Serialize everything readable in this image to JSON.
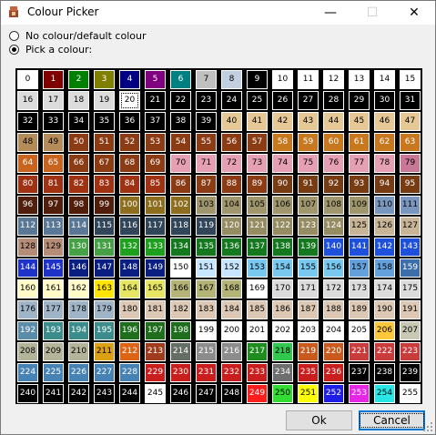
{
  "window": {
    "title": "Colour Picker"
  },
  "titlebar_buttons": {
    "minimize": "—",
    "maximize": "☐",
    "close": "✕"
  },
  "options": {
    "no_colour_label": "No colour/default colour",
    "pick_colour_label": "Pick a colour:",
    "selected": "pick"
  },
  "palette": {
    "columns": 16,
    "selected_index": 20,
    "colors": [
      "#ffffff",
      "#800000",
      "#008000",
      "#808000",
      "#000080",
      "#800080",
      "#008080",
      "#c0c0c0",
      "#c0d0e0",
      "#000000",
      "#ffffff",
      "#ffffff",
      "#ffffff",
      "#ffffff",
      "#ffffff",
      "#ffffff",
      "#dcdcdc",
      "#dcdcdc",
      "#dcdcdc",
      "#dcdcdc",
      "#ffffff",
      "#000000",
      "#000000",
      "#000000",
      "#000000",
      "#000000",
      "#000000",
      "#000000",
      "#000000",
      "#000000",
      "#000000",
      "#000000",
      "#000000",
      "#000000",
      "#000000",
      "#000000",
      "#000000",
      "#000000",
      "#000000",
      "#000000",
      "#e6c896",
      "#e6c896",
      "#e6c896",
      "#e6c896",
      "#e6c896",
      "#e6c896",
      "#e6c896",
      "#e6c896",
      "#b48c5a",
      "#b48c5a",
      "#8c3c14",
      "#8c3c14",
      "#8c3c14",
      "#8c3c14",
      "#8c3c14",
      "#8c3c14",
      "#8c3c14",
      "#8c3c14",
      "#c8781e",
      "#c8781e",
      "#c8781e",
      "#c8781e",
      "#c8781e",
      "#c8781e",
      "#c8641e",
      "#c8641e",
      "#8c3c14",
      "#8c3c14",
      "#8c3c14",
      "#8c3c14",
      "#e6a0b4",
      "#e6a0b4",
      "#e6a0b4",
      "#e6a0b4",
      "#e6a0b4",
      "#e6a0b4",
      "#e6a0b4",
      "#e6a0b4",
      "#e6a0b4",
      "#c87896",
      "#a03214",
      "#a03214",
      "#a03214",
      "#a03214",
      "#a03214",
      "#a03214",
      "#8c3c14",
      "#8c3c14",
      "#8c3c14",
      "#8c3c14",
      "#783c14",
      "#783c14",
      "#783c14",
      "#783c14",
      "#783c14",
      "#783c14",
      "#501e0a",
      "#501e0a",
      "#501e0a",
      "#501e0a",
      "#8c6e1e",
      "#8c6e1e",
      "#8c6e1e",
      "#a0966e",
      "#a0966e",
      "#a0966e",
      "#a0966e",
      "#a0966e",
      "#a0966e",
      "#a0966e",
      "#7896be",
      "#7896be",
      "#5a7896",
      "#5a7896",
      "#5a7896",
      "#32465a",
      "#32465a",
      "#32465a",
      "#32465a",
      "#32465a",
      "#968c64",
      "#968c64",
      "#968c64",
      "#968c64",
      "#968c64",
      "#c8b496",
      "#c8b496",
      "#c8b496",
      "#b48c78",
      "#b48c78",
      "#46a046",
      "#46a046",
      "#1ea01e",
      "#1ea01e",
      "#14781e",
      "#14781e",
      "#14781e",
      "#14781e",
      "#14781e",
      "#14781e",
      "#1e50dc",
      "#1e50dc",
      "#1e50dc",
      "#1e50dc",
      "#1e32c8",
      "#1e32c8",
      "#0a1e82",
      "#0a1e82",
      "#0a1e82",
      "#0a1e82",
      "#ffffff",
      "#c8e6ff",
      "#c8e6ff",
      "#78c8f0",
      "#78c8f0",
      "#78c8f0",
      "#78c8f0",
      "#64a0dc",
      "#64a0dc",
      "#3c6eaa",
      "#fffac8",
      "#fffac8",
      "#fffac8",
      "#ffe600",
      "#e6e664",
      "#e6e664",
      "#b4b478",
      "#b4b478",
      "#b4b478",
      "#ffffff",
      "#dcdcdc",
      "#dcdcdc",
      "#dcdcdc",
      "#dcdcdc",
      "#dcdcdc",
      "#dcdcdc",
      "#a0b4c8",
      "#a0b4c8",
      "#a0b4c8",
      "#a0b4c8",
      "#dcc8b4",
      "#dcc8b4",
      "#dcc8b4",
      "#dcc8b4",
      "#dcc8b4",
      "#dcc8b4",
      "#dcc8b4",
      "#dcc8b4",
      "#dcc8b4",
      "#dcc8b4",
      "#dcc8b4",
      "#dcc8b4",
      "#5a8caa",
      "#3c8c8c",
      "#3c8c8c",
      "#3c8c8c",
      "#1e6e1e",
      "#1e6e1e",
      "#1e6e1e",
      "#ffffff",
      "#ffffff",
      "#ffffff",
      "#ffffff",
      "#ffffff",
      "#ffffff",
      "#ffffff",
      "#ffc83c",
      "#c8c8b4",
      "#b4b49b",
      "#b4b49b",
      "#b4b49b",
      "#dca014",
      "#dc6414",
      "#a03c1e",
      "#646e64",
      "#8c8c8c",
      "#8c8c8c",
      "#1e8c1e",
      "#32c850",
      "#c85a1e",
      "#c85a1e",
      "#c83c3c",
      "#c83c3c",
      "#c83c3c",
      "#4682b4",
      "#4682b4",
      "#4682b4",
      "#4682b4",
      "#4682b4",
      "#c81e1e",
      "#c81e1e",
      "#c81e1e",
      "#c81e1e",
      "#c81e1e",
      "#6e6e6e",
      "#c81e1e",
      "#c81e1e",
      "#000000",
      "#000000",
      "#000000",
      "#000000",
      "#000000",
      "#000000",
      "#000000",
      "#000000",
      "#ffffff",
      "#000000",
      "#000000",
      "#000000",
      "#ff1e1e",
      "#32dc32",
      "#ffff00",
      "#1e1ee6",
      "#e628e6",
      "#28e6e6",
      "#ffffff"
    ]
  },
  "buttons": {
    "ok": "Ok",
    "cancel": "Cancel"
  }
}
